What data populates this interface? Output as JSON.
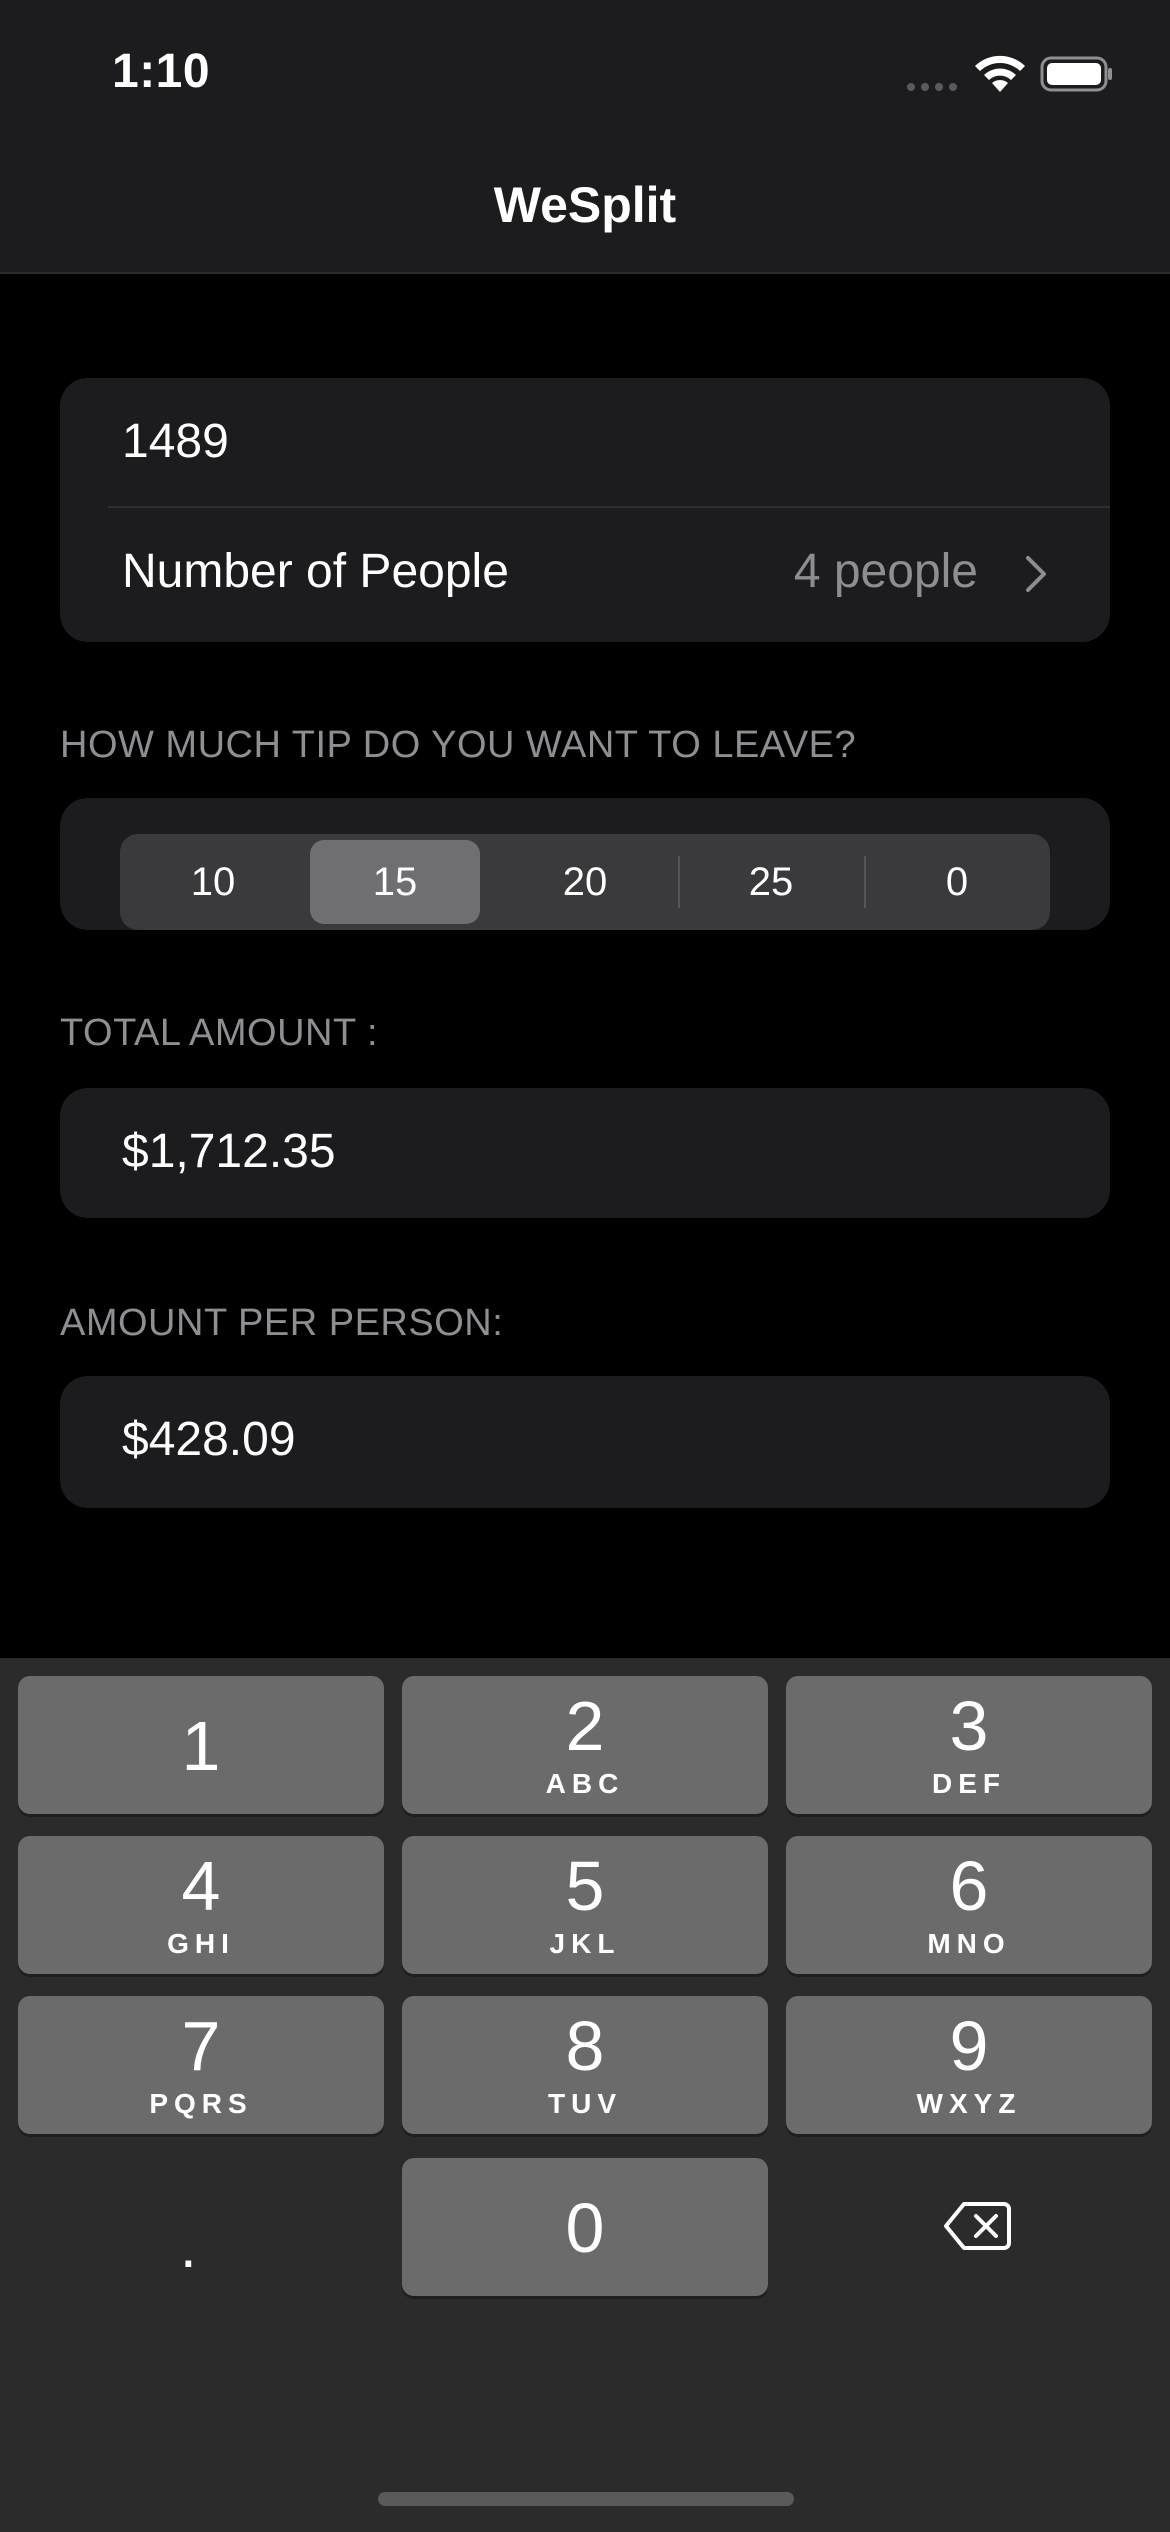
{
  "status_bar": {
    "time": "1:10"
  },
  "nav": {
    "title": "WeSplit"
  },
  "form": {
    "amount_value": "1489",
    "people_label": "Number of People",
    "people_value": "4 people"
  },
  "tip": {
    "header": "HOW MUCH TIP DO YOU WANT TO LEAVE?",
    "options": [
      "10",
      "15",
      "20",
      "25",
      "0"
    ],
    "selected": "15"
  },
  "total": {
    "header": "TOTAL AMOUNT :",
    "value": "$1,712.35"
  },
  "per_person": {
    "header": "AMOUNT PER PERSON:",
    "value": "$428.09"
  },
  "keyboard": {
    "keys": [
      {
        "digit": "1",
        "letters": ""
      },
      {
        "digit": "2",
        "letters": "ABC"
      },
      {
        "digit": "3",
        "letters": "DEF"
      },
      {
        "digit": "4",
        "letters": "GHI"
      },
      {
        "digit": "5",
        "letters": "JKL"
      },
      {
        "digit": "6",
        "letters": "MNO"
      },
      {
        "digit": "7",
        "letters": "PQRS"
      },
      {
        "digit": "8",
        "letters": "TUV"
      },
      {
        "digit": "9",
        "letters": "WXYZ"
      },
      {
        "digit": "0",
        "letters": ""
      }
    ],
    "decimal": ".",
    "delete_icon": "delete-left-icon"
  },
  "colors": {
    "background": "#000000",
    "card": "#1c1c1e",
    "secondary_text": "#8e8e93",
    "key": "#6b6b6b",
    "keyboard_bg": "#2b2b2b",
    "segment_selected": "#6e6e73"
  }
}
